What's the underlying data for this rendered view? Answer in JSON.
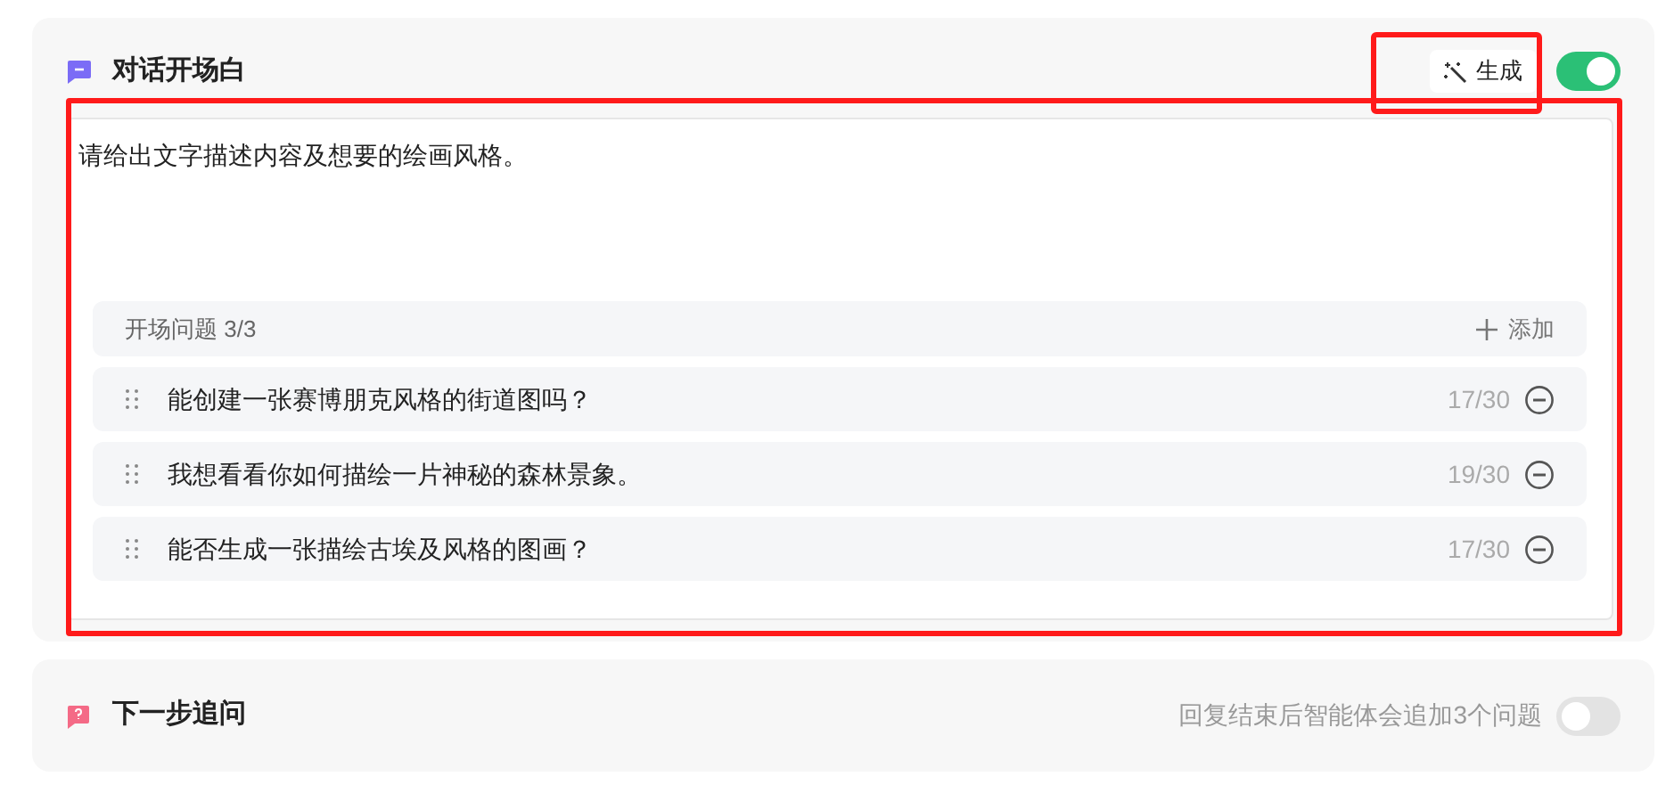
{
  "opening": {
    "title": "对话开场白",
    "generate_label": "生成",
    "enabled": true,
    "text": "请给出文字描述内容及想要的绘画风格。",
    "questions": {
      "header": "开场问题 3/3",
      "add_label": "添加",
      "items": [
        {
          "text": "能创建一张赛博朋克风格的街道图吗？",
          "count": "17/30"
        },
        {
          "text": "我想看看你如何描绘一片神秘的森林景象。",
          "count": "19/30"
        },
        {
          "text": "能否生成一张描绘古埃及风格的图画？",
          "count": "17/30"
        }
      ]
    }
  },
  "follow_up": {
    "title": "下一步追问",
    "hint": "回复结束后智能体会追加3个问题",
    "enabled": false
  }
}
